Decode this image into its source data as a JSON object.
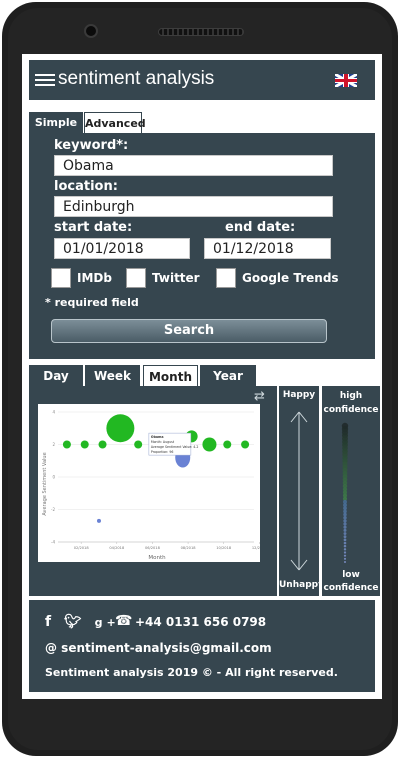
{
  "header": {
    "title": "sentiment analysis",
    "menu_icon": "hamburger-icon",
    "language_icon": "uk-flag-icon"
  },
  "search_tabs": [
    {
      "label": "Simple",
      "active": true
    },
    {
      "label": "Advanced",
      "active": false
    }
  ],
  "form": {
    "keyword_label": "keyword*:",
    "keyword_value": "Obama",
    "location_label": "location:",
    "location_value": "Edinburgh",
    "start_label": "start date:",
    "start_value": "01/01/2018",
    "end_label": "end date:",
    "end_value": "01/12/2018",
    "sources": [
      {
        "label": "IMDb",
        "checked": false
      },
      {
        "label": "Twitter",
        "checked": false
      },
      {
        "label": "Google Trends",
        "checked": false
      }
    ],
    "required_note": "* required field",
    "search_button": "Search"
  },
  "period_tabs": [
    {
      "label": "Day",
      "active": false
    },
    {
      "label": "Week",
      "active": false
    },
    {
      "label": "Month",
      "active": true
    },
    {
      "label": "Year",
      "active": false
    }
  ],
  "chart_data": {
    "type": "scatter",
    "xlabel": "Month",
    "ylabel": "Average Sentiment Value",
    "ylim": [
      -4,
      4
    ],
    "x_ticks": [
      "02/2018",
      "04/2018",
      "06/2018",
      "08/2018",
      "10/2018",
      "12/2018"
    ],
    "grid": true,
    "tooltip": [
      "Obama",
      "Month: August",
      "Average Sentiment Value: 4.2",
      "Proportion: 96"
    ],
    "series": [
      {
        "color": "#22b822",
        "points": [
          {
            "x": 1,
            "y": 2,
            "size": 2
          },
          {
            "x": 2,
            "y": 2,
            "size": 2
          },
          {
            "x": 3,
            "y": 2,
            "size": 2
          },
          {
            "x": 4,
            "y": 3,
            "size": 7
          },
          {
            "x": 5,
            "y": 2,
            "size": 2
          },
          {
            "x": 6,
            "y": 2,
            "size": 2
          },
          {
            "x": 7,
            "y": 2,
            "size": 2
          },
          {
            "x": 8,
            "y": 2.5,
            "size": 3
          },
          {
            "x": 9,
            "y": 2,
            "size": 3.5
          },
          {
            "x": 10,
            "y": 2,
            "size": 2
          },
          {
            "x": 11,
            "y": 2,
            "size": 2
          }
        ]
      },
      {
        "color": "#6a82d4",
        "points": [
          {
            "x": 2.8,
            "y": -2.7,
            "size": 1
          },
          {
            "x": 7.5,
            "y": 1.2,
            "size": 5
          }
        ]
      }
    ]
  },
  "happiness_scale": {
    "top": "Happy",
    "bottom": "Unhappy"
  },
  "confidence_scale": {
    "top": [
      "high",
      "confidence"
    ],
    "bottom": [
      "low",
      "confidence"
    ]
  },
  "footer": {
    "social": "f  g+",
    "phone": "+44 0131 656 0798",
    "email": "@ sentiment-analysis@gmail.com",
    "copyright": "Sentiment analysis 2019 © - All right reserved."
  }
}
